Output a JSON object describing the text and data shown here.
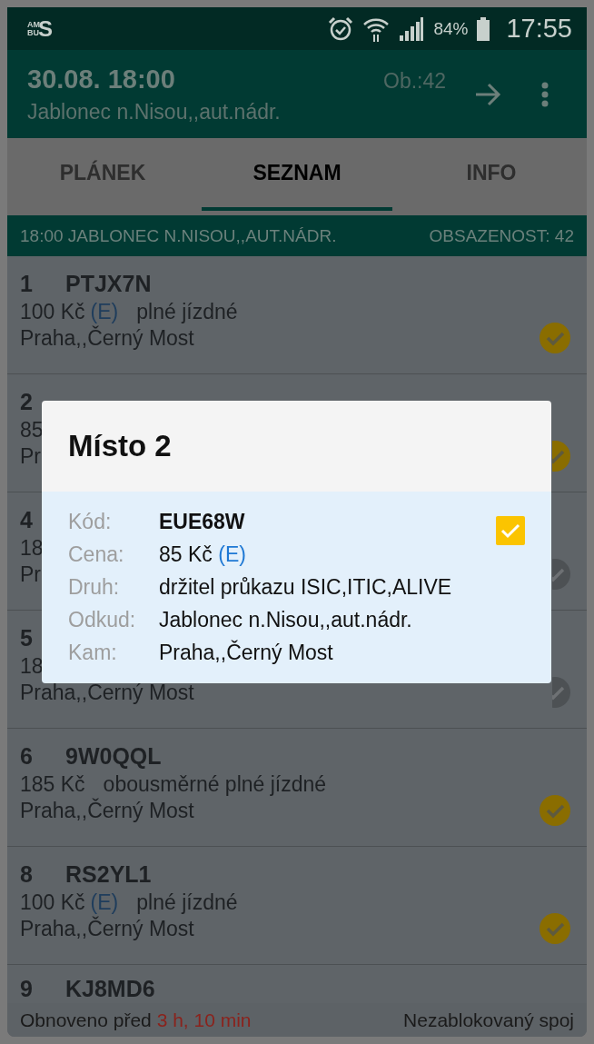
{
  "status_bar": {
    "logo": {
      "top": "AM",
      "bottom": "BU",
      "big": "S"
    },
    "battery": "84%",
    "time": "17:55"
  },
  "app_bar": {
    "title": "30.08. 18:00",
    "occupancy": "Ob.:42",
    "subtitle": "Jablonec n.Nisou,,aut.nádr."
  },
  "tabs": [
    {
      "label": "PLÁNEK",
      "selected": false
    },
    {
      "label": "SEZNAM",
      "selected": true
    },
    {
      "label": "INFO",
      "selected": false
    }
  ],
  "header": {
    "departure": "18:00 JABLONEC N.NISOU,,AUT.NÁDR.",
    "occupancy": "OBSAZENOST: 42"
  },
  "seats": [
    {
      "number": "1",
      "code": "PTJX7N",
      "price": "100 Kč",
      "discount": "(E)",
      "fare": "plné jízdné",
      "route": "Praha,,Černý Most",
      "checked": true
    },
    {
      "number": "2",
      "price": "85",
      "route": "Pr",
      "checked": true
    },
    {
      "number": "4",
      "price": "18",
      "route": "Pr",
      "checked": false
    },
    {
      "number": "5",
      "price": "18",
      "route": "Praha,,Černý Most",
      "checked": false
    },
    {
      "number": "6",
      "code": "9W0QQL",
      "price": "185 Kč",
      "fare": "obousměrné plné jízdné",
      "route": "Praha,,Černý Most",
      "checked": true
    },
    {
      "number": "8",
      "code": "RS2YL1",
      "price": "100 Kč",
      "discount": "(E)",
      "fare": "plné jízdné",
      "route": "Praha,,Černý Most",
      "checked": true
    },
    {
      "number": "9",
      "code": "KJ8MD6"
    }
  ],
  "dialog": {
    "title": "Místo 2",
    "checked": true,
    "fields": [
      {
        "label": "Kód:",
        "value": "EUE68W",
        "kind": "code"
      },
      {
        "label": "Cena:",
        "value": "85 Kč",
        "discount": "(E)",
        "kind": "price"
      },
      {
        "label": "Druh:",
        "value": "držitel průkazu ISIC,ITIC,ALIVE",
        "kind": "text"
      },
      {
        "label": "Odkud:",
        "value": "Jablonec n.Nisou,,aut.nádr.",
        "kind": "text"
      },
      {
        "label": "Kam:",
        "value": "Praha,,Černý Most",
        "kind": "text"
      }
    ]
  },
  "footer": {
    "refreshed": "Obnoveno před",
    "age": "3 h, 10 min",
    "state": "Nezablokovaný spoj"
  }
}
